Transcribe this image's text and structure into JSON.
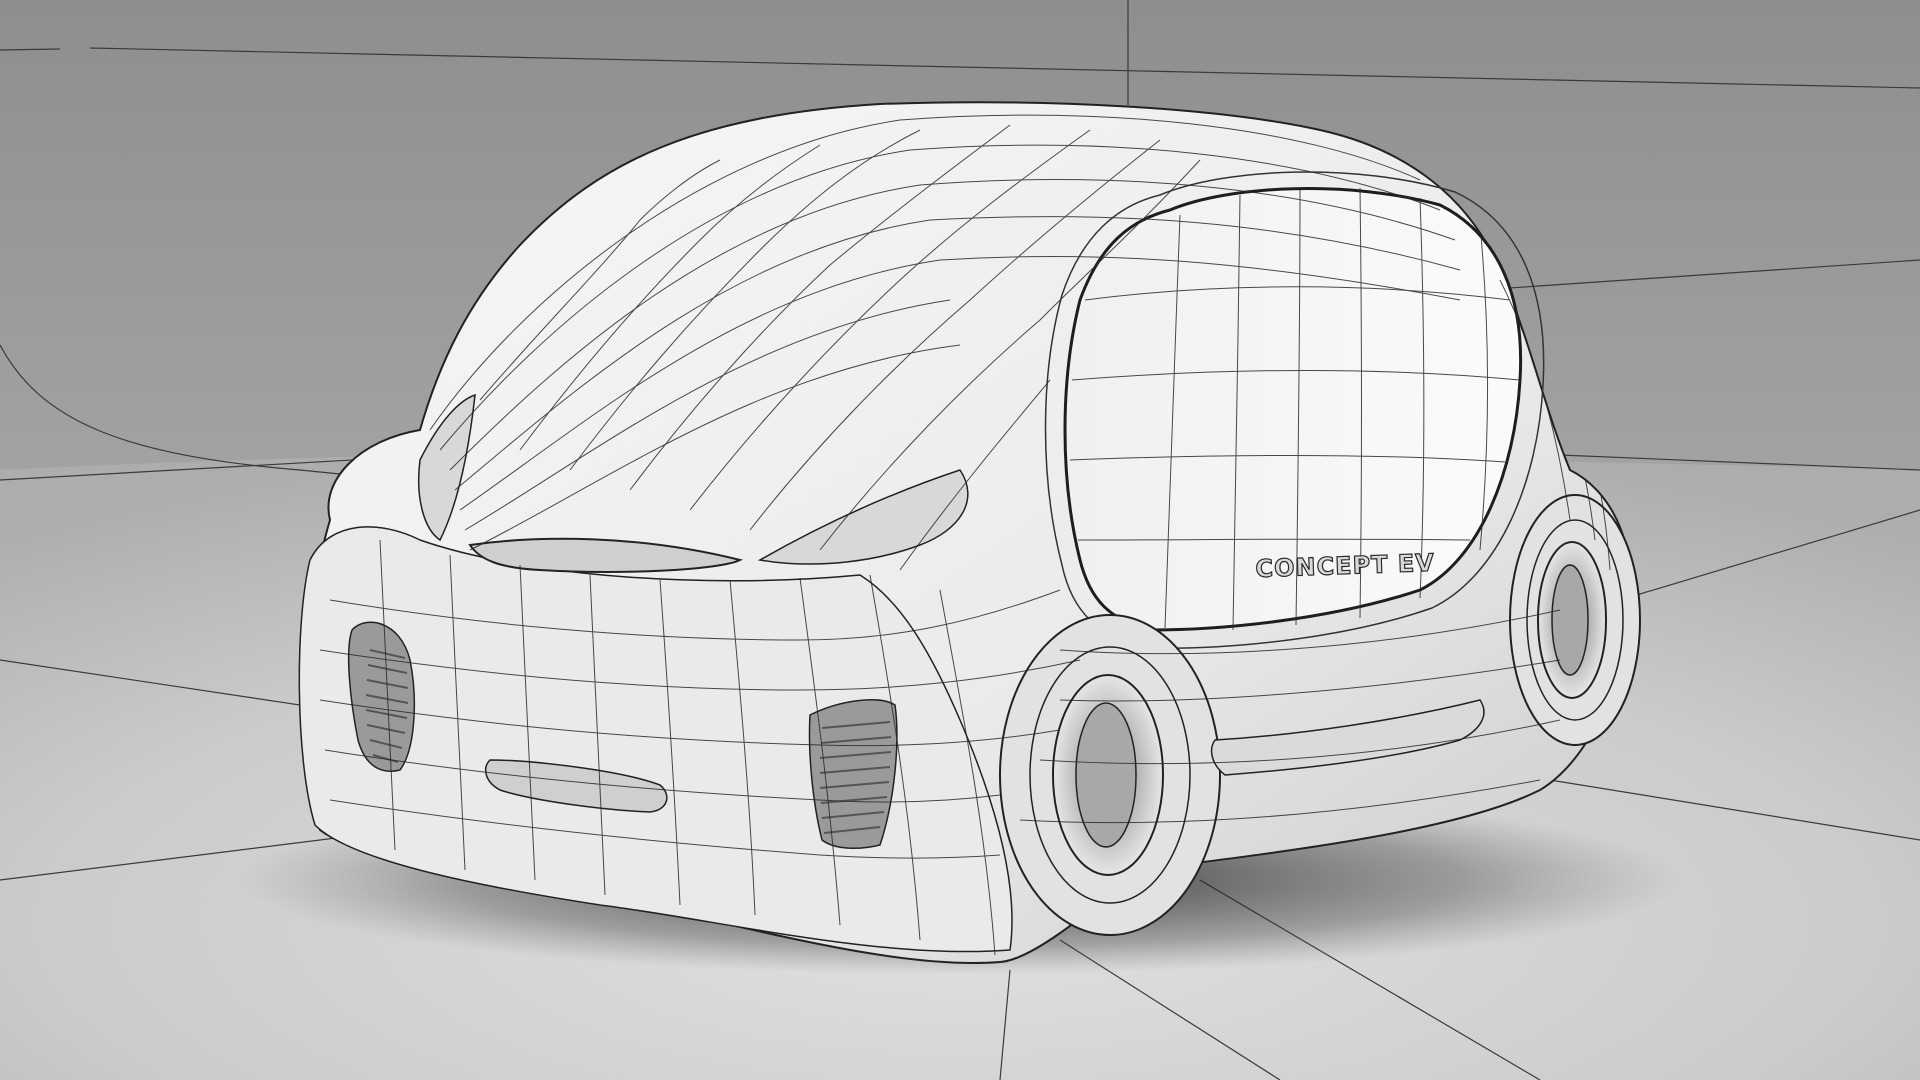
{
  "model_badge": "CONCEPT EV"
}
